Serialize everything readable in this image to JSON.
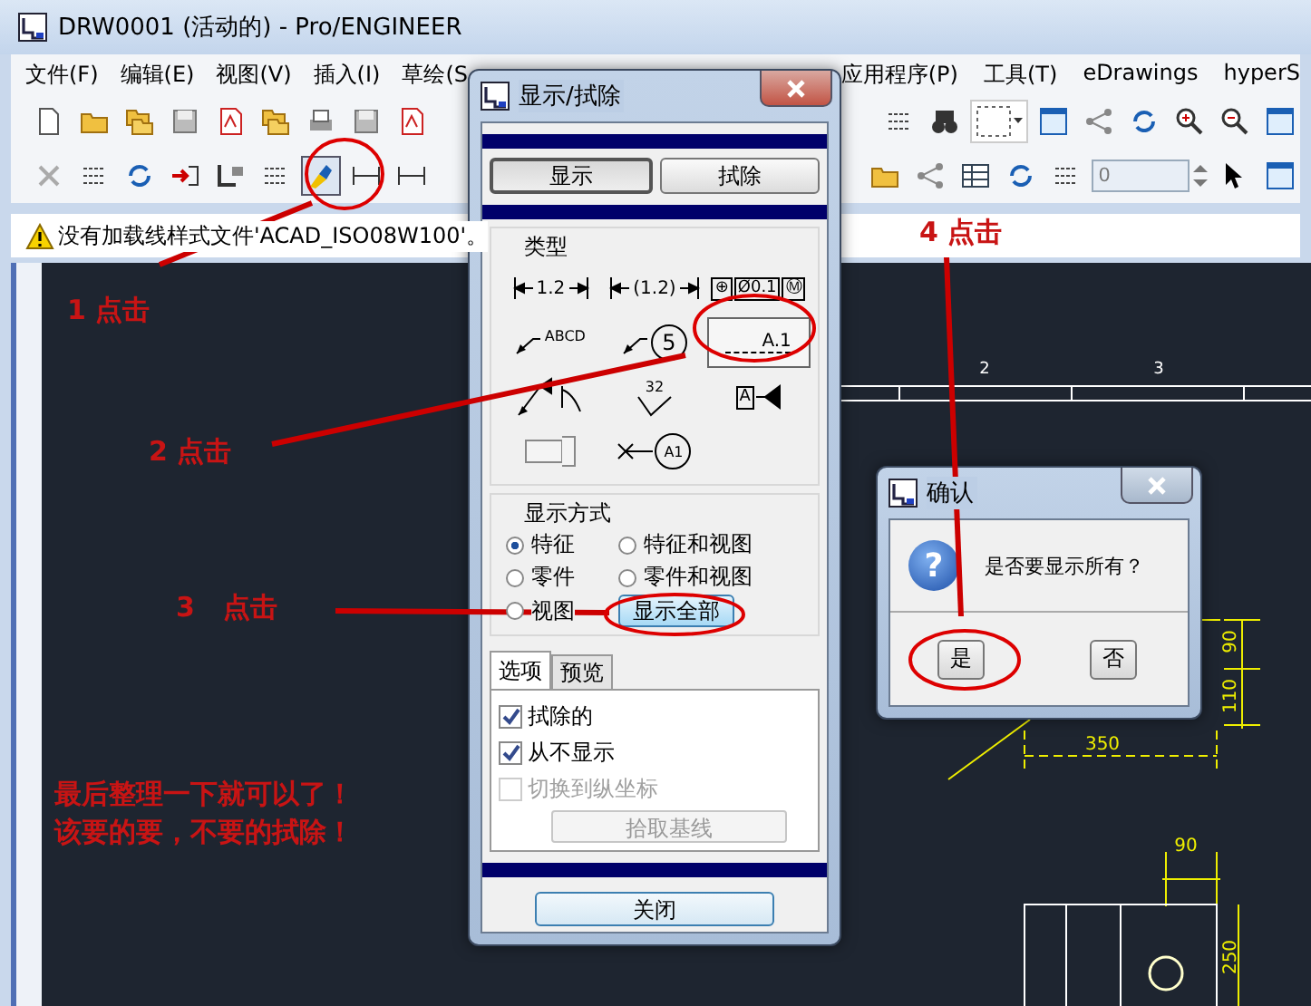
{
  "window": {
    "title": "DRW0001 (活动的) - Pro/ENGINEER"
  },
  "menu": {
    "left": [
      "文件(F)",
      "编辑(E)",
      "视图(V)",
      "插入(I)",
      "草绘(S"
    ],
    "right": [
      "应用程序(P)",
      "工具(T)",
      "eDrawings",
      "hyperS"
    ]
  },
  "toolbar": {
    "field_value": "0"
  },
  "message": "没有加载线样式文件'ACAD_ISO08W100'。",
  "drawing": {
    "labels": [
      {
        "text": "2",
        "kind": "zone"
      },
      {
        "text": "3",
        "kind": "zone"
      },
      {
        "text": "90",
        "kind": "vertical"
      },
      {
        "text": "110",
        "kind": "vertical"
      },
      {
        "text": "350",
        "kind": "horizontal"
      },
      {
        "text": "90",
        "kind": "horizontal"
      },
      {
        "text": "250",
        "kind": "vertical"
      }
    ]
  },
  "display_dialog": {
    "title": "显示/拭除",
    "modes": [
      {
        "label": "显示",
        "selected": true
      },
      {
        "label": "拭除",
        "selected": false
      }
    ],
    "type_group": "类型",
    "types": [
      {
        "kind": "dim",
        "parts": [
          "1.2"
        ],
        "selected": false
      },
      {
        "kind": "dim",
        "parts": [
          "(1.2)"
        ],
        "selected": false
      },
      {
        "kind": "gtol",
        "parts": [
          "⊕",
          "Ø0.1",
          "Ⓜ"
        ],
        "selected": false
      },
      {
        "kind": "note",
        "parts": [
          "ABCD"
        ],
        "selected": false
      },
      {
        "kind": "balloon",
        "parts": [
          "5"
        ],
        "selected": false
      },
      {
        "kind": "axis",
        "parts": [
          "A.1"
        ],
        "selected": true
      },
      {
        "kind": "flag",
        "selected": false
      },
      {
        "kind": "finish",
        "parts": [
          "32"
        ],
        "selected": false
      },
      {
        "kind": "datum",
        "parts": [
          "A"
        ],
        "selected": false
      },
      {
        "kind": "cosmetic",
        "selected": false
      },
      {
        "kind": "target",
        "parts": [
          "A1"
        ],
        "selected": false
      }
    ],
    "display_group": "显示方式",
    "display_by": [
      {
        "label": "特征",
        "selected": true
      },
      {
        "label": "特征和视图",
        "selected": false
      },
      {
        "label": "零件",
        "selected": false
      },
      {
        "label": "零件和视图",
        "selected": false
      },
      {
        "label": "视图",
        "selected": false
      }
    ],
    "show_all_button": "显示全部",
    "tabs": [
      {
        "label": "选项",
        "selected": true
      },
      {
        "label": "预览",
        "selected": false
      }
    ],
    "options": [
      {
        "label": "拭除的",
        "checked": true,
        "disabled": false
      },
      {
        "label": "从不显示",
        "checked": true,
        "disabled": false
      },
      {
        "label": "切换到纵坐标",
        "checked": false,
        "disabled": true
      }
    ],
    "pick_baseline_button": {
      "label": "拾取基线",
      "disabled": true
    },
    "close_button": "关闭"
  },
  "confirm_dialog": {
    "title": "确认",
    "icon_glyph": "?",
    "message": "是否要显示所有？",
    "buttons": [
      "是",
      "否"
    ]
  },
  "annotations": {
    "steps": [
      "1 点击",
      "2 点击",
      "3   点击",
      "4 点击"
    ],
    "note": [
      "最后整理一下就可以了！",
      "该要的要，不要的拭除！"
    ]
  }
}
